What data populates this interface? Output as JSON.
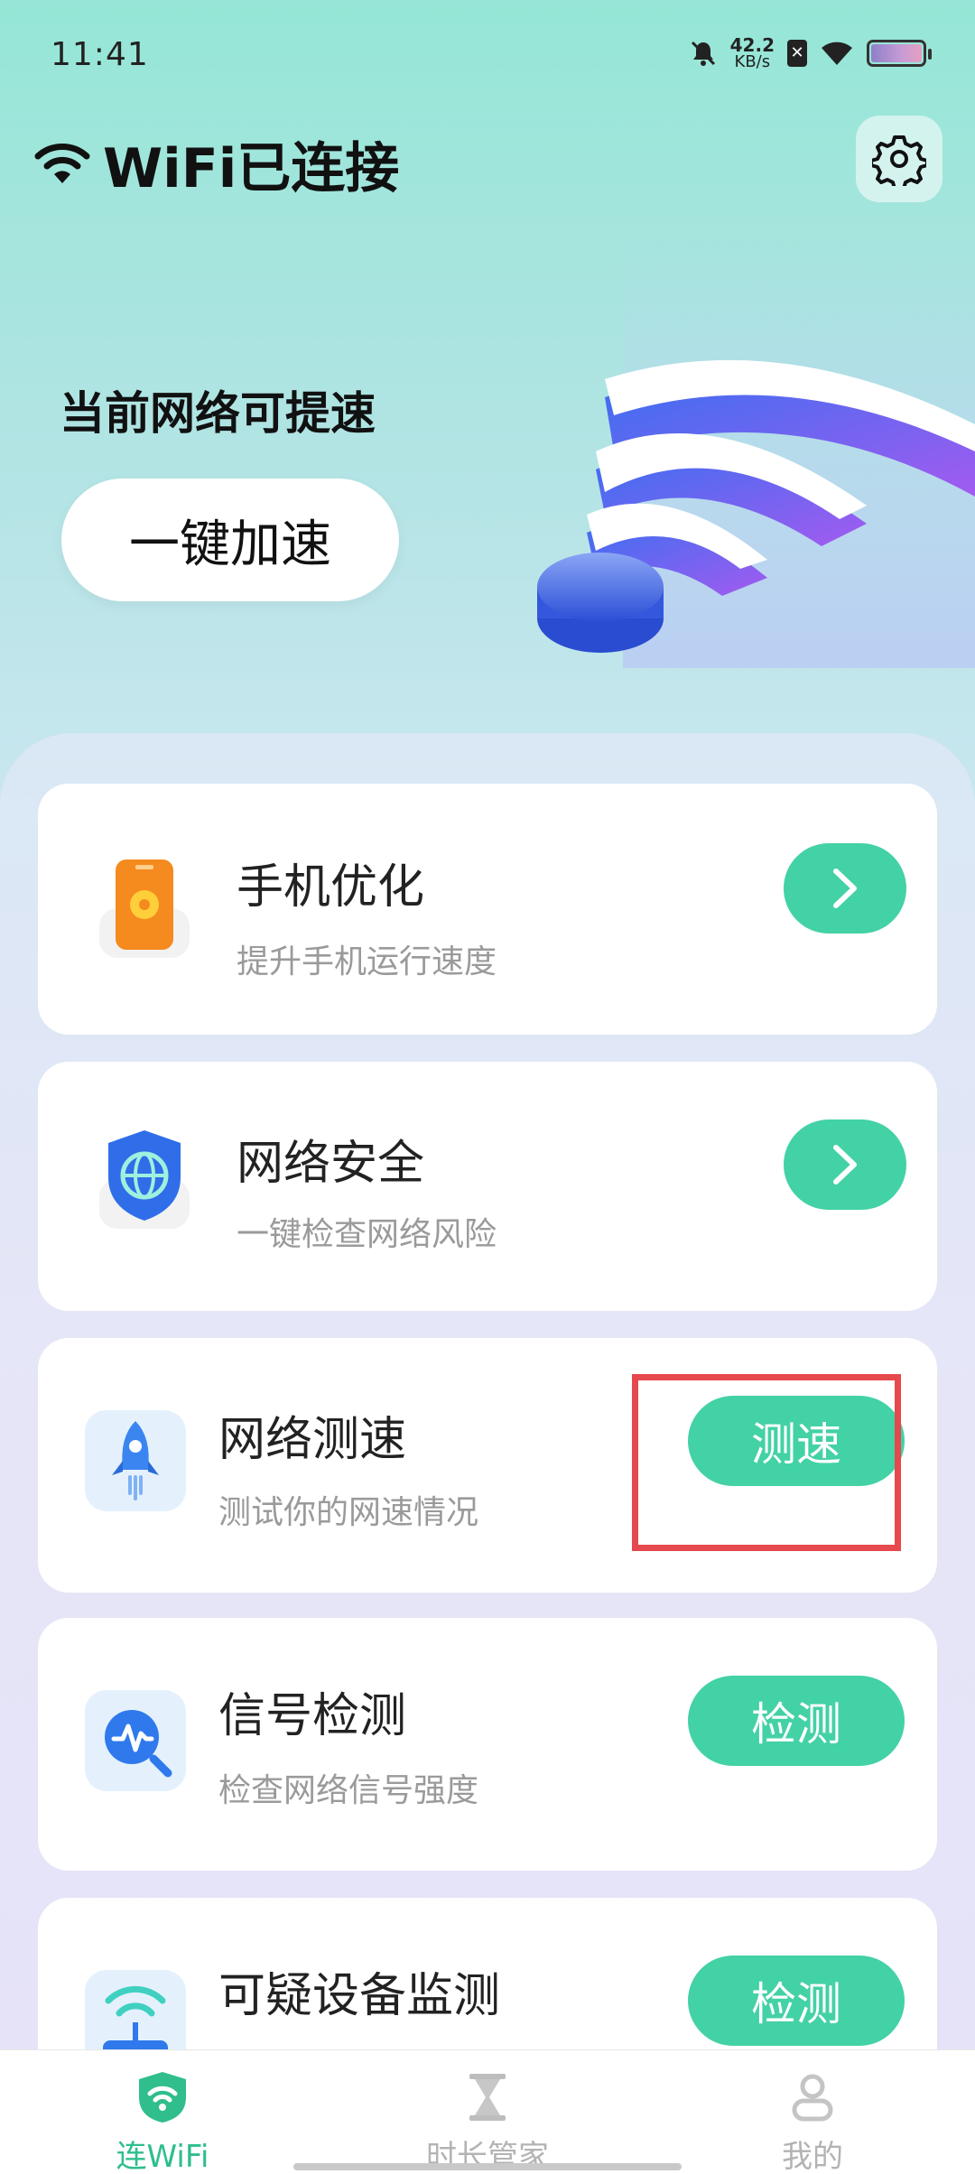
{
  "status_bar": {
    "time": "11:41",
    "speed_value": "42.2",
    "speed_unit": "KB/s"
  },
  "header": {
    "title": "WiFi已连接"
  },
  "hero": {
    "subtitle": "当前网络可提速",
    "boost_button": "一键加速"
  },
  "cards": [
    {
      "title": "手机优化",
      "desc": "提升手机运行速度",
      "action": "arrow",
      "icon": "phone-gear-icon"
    },
    {
      "title": "网络安全",
      "desc": "一键检查网络风险",
      "action": "arrow",
      "icon": "shield-globe-icon"
    },
    {
      "title": "网络测速",
      "desc": "测试你的网速情况",
      "action_label": "测速",
      "icon": "rocket-icon"
    },
    {
      "title": "信号检测",
      "desc": "检查网络信号强度",
      "action_label": "检测",
      "icon": "signal-search-icon"
    },
    {
      "title": "可疑设备监测",
      "action_label": "检测",
      "icon": "router-icon"
    }
  ],
  "bottom_nav": [
    {
      "label": "连WiFi",
      "active": true,
      "icon": "wifi-shield-icon"
    },
    {
      "label": "时长管家",
      "active": false,
      "icon": "hourglass-icon"
    },
    {
      "label": "我的",
      "active": false,
      "icon": "user-icon"
    }
  ],
  "colors": {
    "accent": "#43d1a6",
    "highlight": "#e5484d",
    "nav_active": "#2fbe8c"
  }
}
